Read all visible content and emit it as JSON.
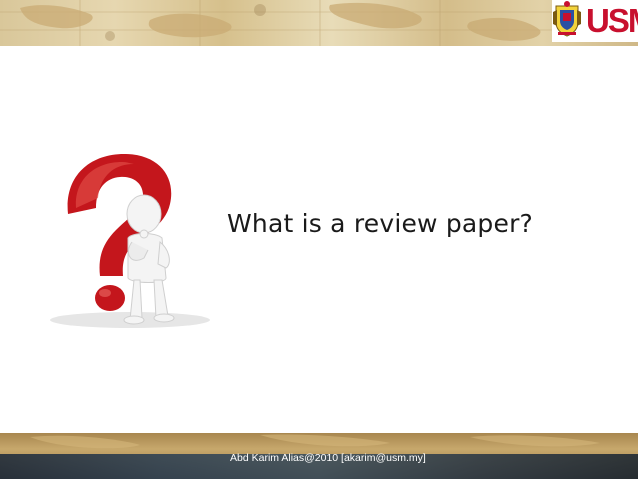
{
  "slide": {
    "title": "What is a review paper?",
    "footer": "Abd Karim Alias@2010 [akarim@usm.my]"
  },
  "logo": {
    "text": "USM",
    "crest_icon": "usm-crest-icon"
  },
  "illustration": {
    "icon": "thinking-person-question-mark-icon"
  },
  "colors": {
    "title": "#1a1a1a",
    "logo_red": "#c8102e",
    "question_mark": "#c4161c"
  }
}
